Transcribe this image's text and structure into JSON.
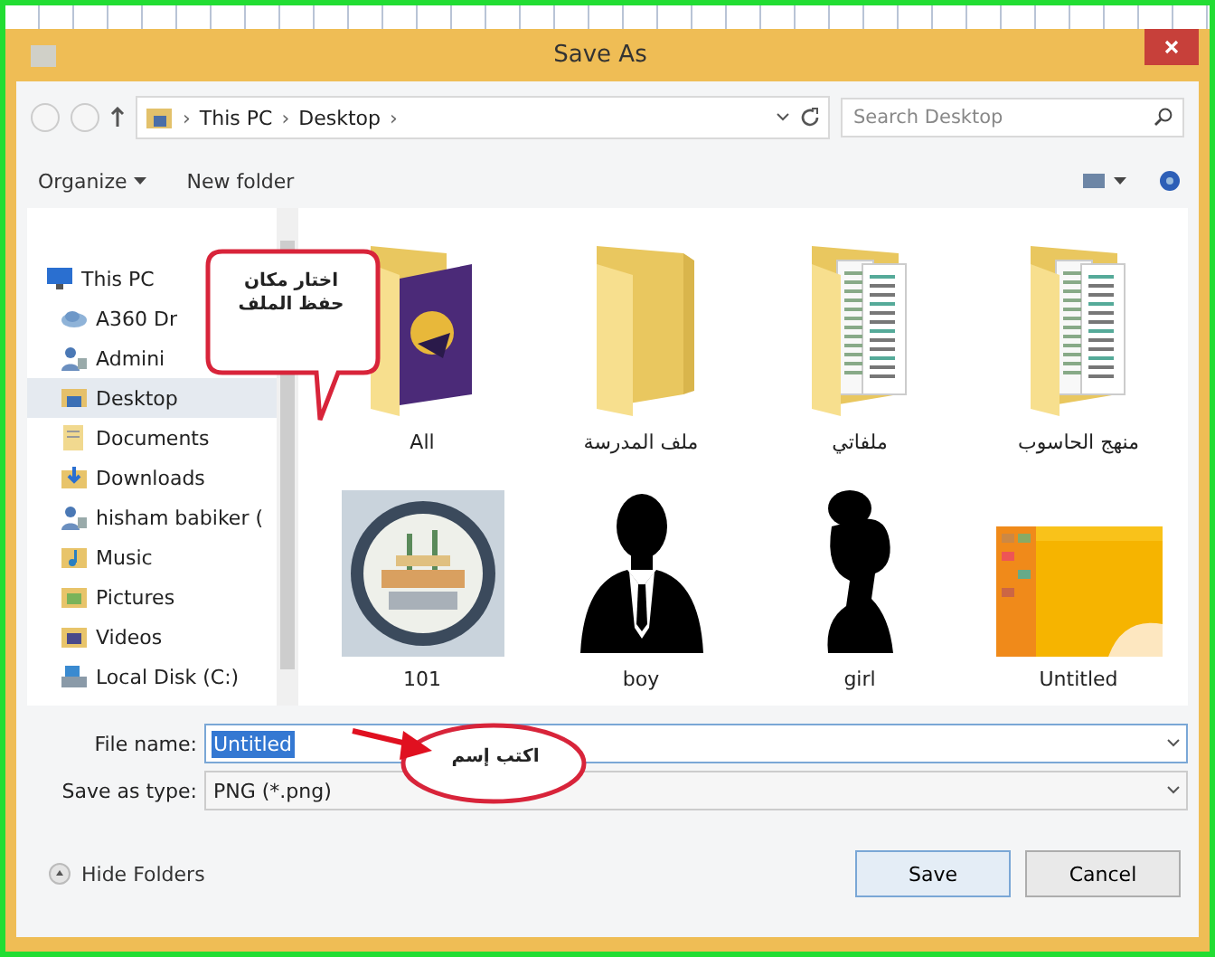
{
  "window": {
    "title": "Save As"
  },
  "nav": {
    "path": [
      {
        "separator": "›",
        "label": "This PC"
      },
      {
        "separator": "›",
        "label": "Desktop"
      }
    ],
    "trailing_separator": "›",
    "search": {
      "placeholder": "Search Desktop"
    }
  },
  "toolbar": {
    "organize": "Organize",
    "new_folder": "New folder"
  },
  "sidebar": {
    "items": [
      {
        "label": "This PC",
        "kind": "pc",
        "selected": false,
        "children": [
          {
            "label": "A360 Dr",
            "kind": "cloud",
            "selected": false
          },
          {
            "label": "Admini",
            "kind": "user",
            "selected": false
          },
          {
            "label": "Desktop",
            "kind": "desktop",
            "selected": true
          },
          {
            "label": "Documents",
            "kind": "documents",
            "selected": false
          },
          {
            "label": "Downloads",
            "kind": "downloads",
            "selected": false
          },
          {
            "label": "hisham babiker (",
            "kind": "user",
            "selected": false
          },
          {
            "label": "Music",
            "kind": "music",
            "selected": false
          },
          {
            "label": "Pictures",
            "kind": "pictures",
            "selected": false
          },
          {
            "label": "Videos",
            "kind": "videos",
            "selected": false
          },
          {
            "label": "Local Disk (C:)",
            "kind": "disk",
            "selected": false
          }
        ]
      }
    ]
  },
  "files": [
    {
      "name": "All",
      "kind": "image-folder"
    },
    {
      "name": "ملف المدرسة",
      "kind": "folder"
    },
    {
      "name": "ملفاتي",
      "kind": "doc-folder"
    },
    {
      "name": "منهج الحاسوب",
      "kind": "doc-folder"
    },
    {
      "name": "101",
      "kind": "emblem"
    },
    {
      "name": "boy",
      "kind": "man-silhouette"
    },
    {
      "name": "girl",
      "kind": "woman-silhouette"
    },
    {
      "name": "Untitled",
      "kind": "picture"
    }
  ],
  "form": {
    "file_name": {
      "label": "File name:",
      "value": "Untitled",
      "selected": true
    },
    "save_as_type": {
      "label": "Save as type:",
      "value": "PNG (*.png)"
    }
  },
  "footer": {
    "hide_folders": "Hide Folders",
    "buttons": [
      {
        "label": "Save",
        "default": true
      },
      {
        "label": "Cancel",
        "default": false
      }
    ]
  },
  "annotations": [
    {
      "text": "اختار مكان حفظ الملف",
      "kind": "speech-bubble"
    },
    {
      "text": "اكتب إسم",
      "kind": "ellipse-arrow"
    }
  ]
}
